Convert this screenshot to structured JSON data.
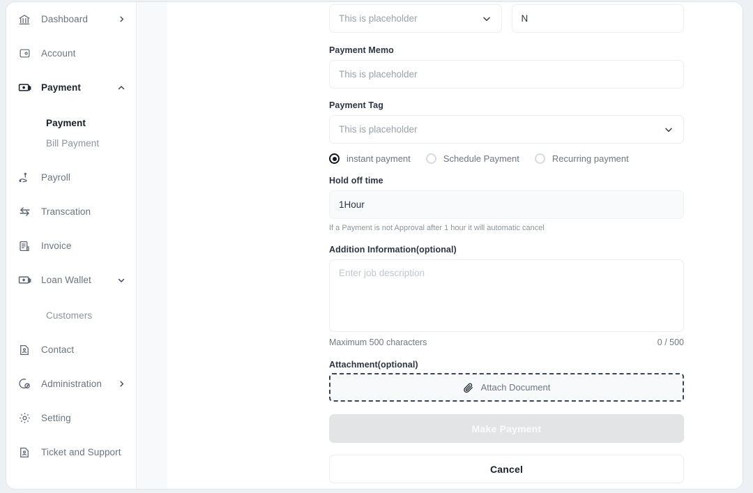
{
  "sidebar": {
    "items": [
      {
        "label": "Dashboard",
        "icon": "bank-icon",
        "chevron": "right",
        "active": false
      },
      {
        "label": "Account",
        "icon": "wallet-icon",
        "chevron": "",
        "active": false
      },
      {
        "label": "Payment",
        "icon": "banknote-icon",
        "chevron": "up",
        "active": true
      },
      {
        "label": "Payroll",
        "icon": "payroll-hand-icon",
        "chevron": "",
        "active": false
      },
      {
        "label": "Transcation",
        "icon": "transfer-arrows-icon",
        "chevron": "",
        "active": false
      },
      {
        "label": "Invoice",
        "icon": "invoice-icon",
        "chevron": "",
        "active": false
      },
      {
        "label": "Loan  Wallet",
        "icon": "banknote-icon",
        "chevron": "down",
        "active": false
      },
      {
        "label": "Contact",
        "icon": "contact-card-icon",
        "chevron": "",
        "active": false
      },
      {
        "label": "Administration",
        "icon": "admin-shield-icon",
        "chevron": "right",
        "active": false
      },
      {
        "label": "Setting",
        "icon": "gear-icon",
        "chevron": "",
        "active": false
      },
      {
        "label": "Ticket and Support",
        "icon": "ticket-icon",
        "chevron": "",
        "active": false
      }
    ],
    "payment_subitems": [
      {
        "label": "Payment",
        "active": true
      },
      {
        "label": "Bill Payment",
        "active": false
      }
    ],
    "loan_subitems": [
      {
        "label": "Customers",
        "active": false
      }
    ]
  },
  "form": {
    "top_select": {
      "placeholder": "This is placeholder",
      "value": ""
    },
    "top_text": {
      "placeholder": "",
      "value": "N"
    },
    "payment_memo": {
      "label": "Payment  Memo",
      "placeholder": "This is placeholder",
      "value": ""
    },
    "payment_tag": {
      "label": "Payment Tag",
      "placeholder": "This is placeholder",
      "value": ""
    },
    "payment_type": {
      "options": [
        {
          "label": "instant payment",
          "checked": true
        },
        {
          "label": "Schedule Payment",
          "checked": false
        },
        {
          "label": "Recurring payment",
          "checked": false
        }
      ]
    },
    "hold_off_time": {
      "label": "Hold off time",
      "value": "1Hour",
      "helper": "If a Payment is not Approval after 1 hour it will automatic cancel"
    },
    "addition_information": {
      "label": "Addition Information(optional)",
      "placeholder": "Enter job description",
      "value": "",
      "max_hint": "Maximum 500 characters",
      "counter": "0 / 500"
    },
    "attachment": {
      "label": "Attachment(optional)",
      "button_label": "Attach Document",
      "icon": "paperclip-icon"
    },
    "actions": {
      "submit_label": "Make Payment",
      "submit_disabled": true,
      "cancel_label": "Cancel"
    }
  },
  "colors": {
    "page_background": "#eef1f3",
    "card_background": "#ffffff",
    "gutter": "#f8f9fa",
    "text_primary": "#2b3442",
    "text_muted": "#8b939e",
    "placeholder": "#9aa1ab",
    "border": "#eceef0",
    "disabled_button": "#e3e4e6",
    "radio_checked": "#12161d",
    "dropzone_border": "#3b4351"
  }
}
